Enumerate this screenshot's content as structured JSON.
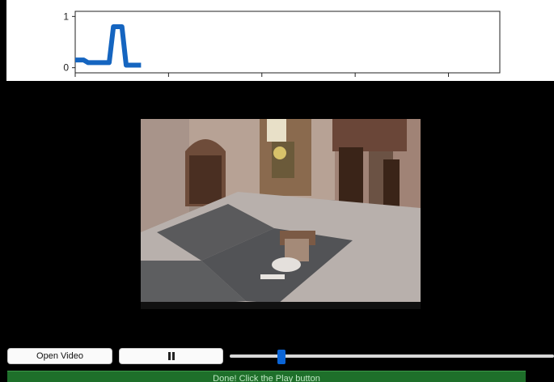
{
  "plot": {
    "chart_data": {
      "type": "line",
      "x": [
        0,
        1,
        2,
        3,
        4,
        5,
        6,
        7,
        8,
        9,
        10,
        11,
        12,
        13,
        14
      ],
      "y": [
        0.15,
        0.15,
        0.15,
        0.1,
        0.1,
        0.1,
        0.1,
        0.1,
        0.8,
        0.8,
        0.8,
        0.8,
        0.05,
        0.05,
        0.05
      ],
      "yticks": [
        0,
        1
      ],
      "ylim": [
        -0.1,
        1.1
      ],
      "xlim": [
        0,
        100
      ],
      "xtick_count": 5,
      "line_color": "#1565c0"
    }
  },
  "controls": {
    "open_video_label": "Open Video",
    "pause_icon": "pause-icon",
    "slider_value": 0.16
  },
  "status": {
    "message": "Done! Click the Play button"
  }
}
